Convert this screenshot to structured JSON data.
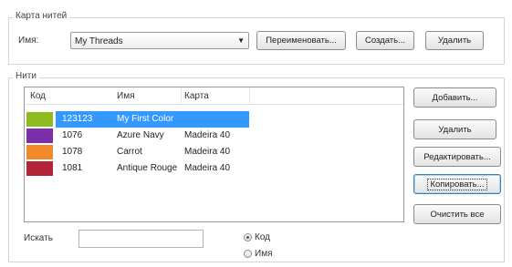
{
  "thread_map": {
    "group_label": "Карта нитей",
    "name_label": "Имя:",
    "selected_map": "My Threads",
    "rename_label": "Переименовать...",
    "create_label": "Создать...",
    "delete_label": "Удалить"
  },
  "threads": {
    "group_label": "Нити",
    "columns": [
      "Код",
      "Имя",
      "Карта"
    ],
    "rows": [
      {
        "color": "#8fbb1e",
        "code": "123123",
        "name": "My First Color",
        "map": "",
        "selected": true
      },
      {
        "color": "#7a2fa8",
        "code": "1076",
        "name": "Azure Navy",
        "map": "Madeira 40",
        "selected": false
      },
      {
        "color": "#f08a2a",
        "code": "1078",
        "name": "Carrot",
        "map": "Madeira 40",
        "selected": false
      },
      {
        "color": "#b3243a",
        "code": "1081",
        "name": "Antique Rouge",
        "map": "Madeira 40",
        "selected": false
      }
    ],
    "buttons": {
      "add": "Добавить...",
      "delete": "Удалить",
      "edit": "Редактировать...",
      "copy": "Копировать...",
      "clear_all": "Очистить все"
    },
    "search": {
      "label": "Искать",
      "value": "",
      "radio_code": "Код",
      "radio_name": "Имя",
      "selected_radio": "code"
    }
  }
}
